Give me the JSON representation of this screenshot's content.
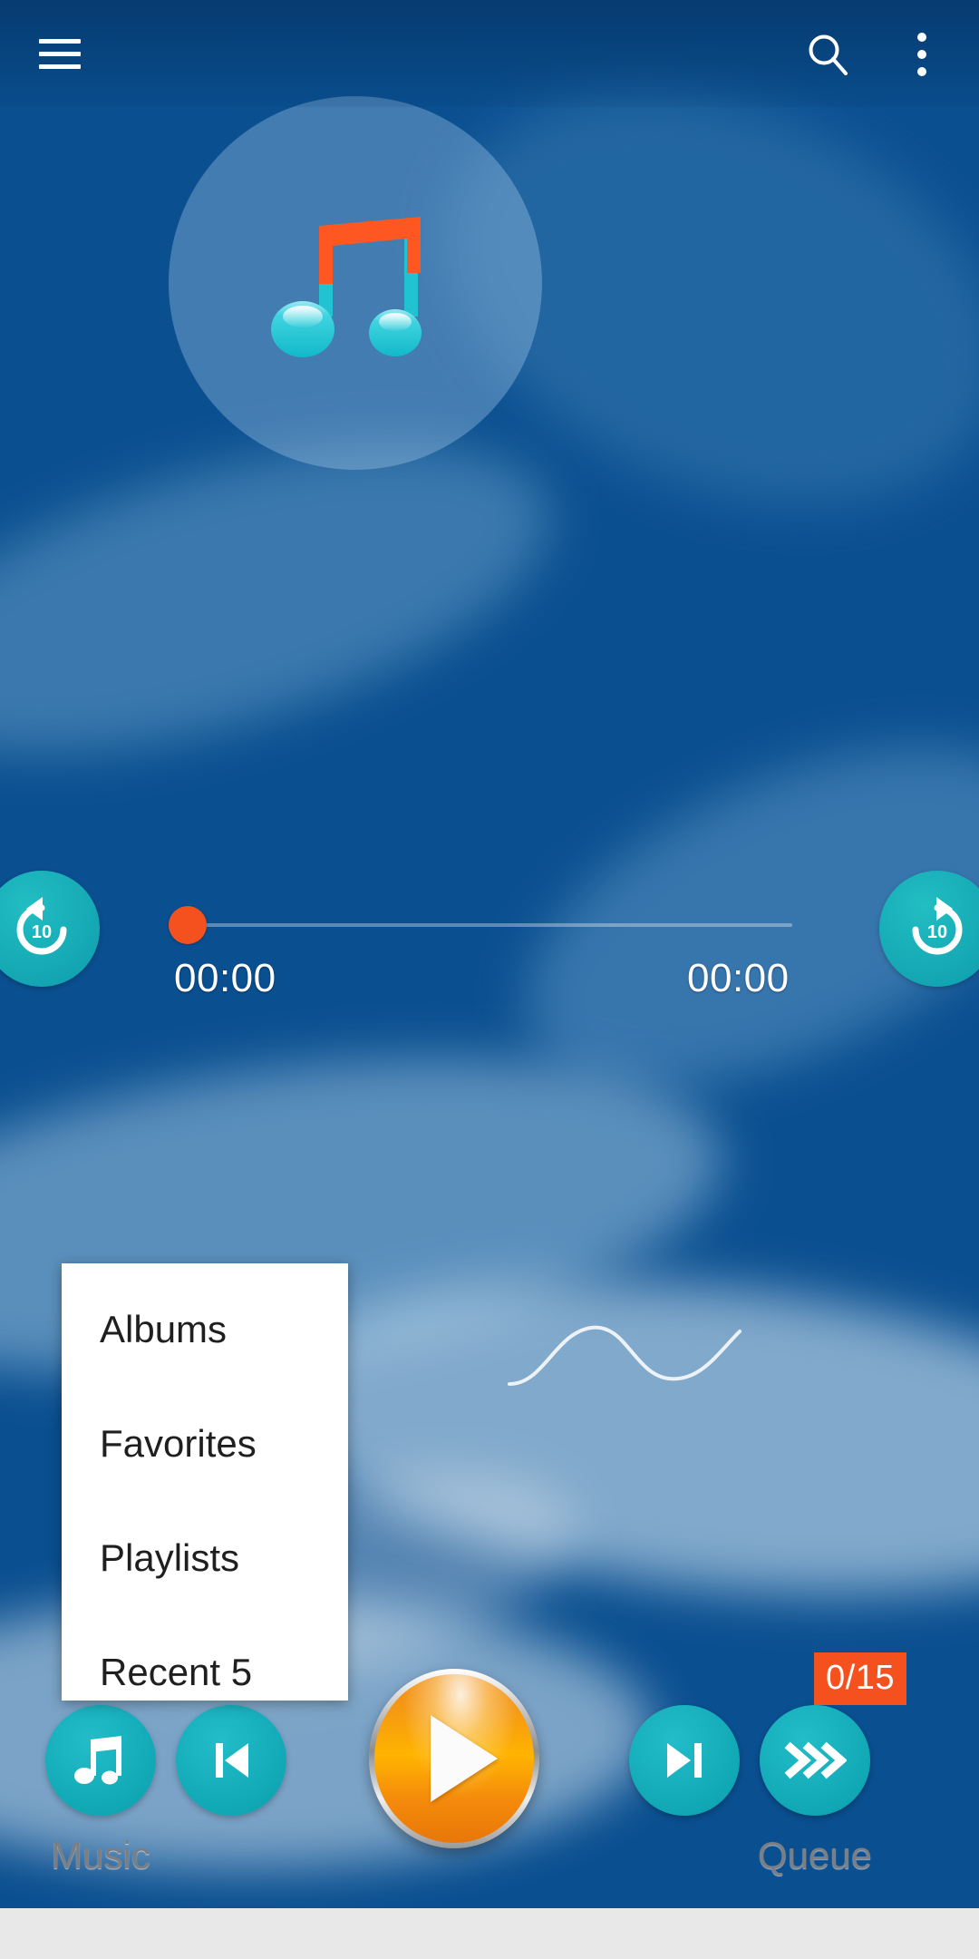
{
  "app": {
    "background_top_color": "#01427f",
    "background_bottom_color": "#cfe8f8",
    "accent_teal": "#12a8b4",
    "accent_orange": "#f4511e",
    "play_orange": "#ffb400"
  },
  "topbar": {
    "menu_icon": "hamburger-menu-icon",
    "search_icon": "search-icon",
    "overflow_icon": "more-vertical-icon"
  },
  "album": {
    "art_placeholder_icon": "music-note-icon",
    "note_beam_color": "#ff5722",
    "note_head_color": "#1ec8d4"
  },
  "player": {
    "rewind_label": "10",
    "rewind_icon": "replay-10-icon",
    "forward_label": "10",
    "forward_icon": "forward-10-icon",
    "elapsed_time": "00:00",
    "total_time": "00:00",
    "seek_progress_percent": 0,
    "seek_thumb_color": "#f4511e"
  },
  "popup_menu": {
    "items": [
      {
        "label": "Albums"
      },
      {
        "label": "Favorites"
      },
      {
        "label": "Playlists"
      },
      {
        "label": "Recent 5"
      }
    ]
  },
  "bottom_controls": {
    "music_label": "Music",
    "music_icon": "music-note-icon",
    "previous_icon": "skip-previous-icon",
    "play_icon": "play-icon",
    "next_icon": "skip-next-icon",
    "queue_icon": "triple-chevron-right-icon",
    "queue_label": "Queue",
    "queue_badge": "0/15",
    "queue_badge_color": "#f4511e"
  }
}
